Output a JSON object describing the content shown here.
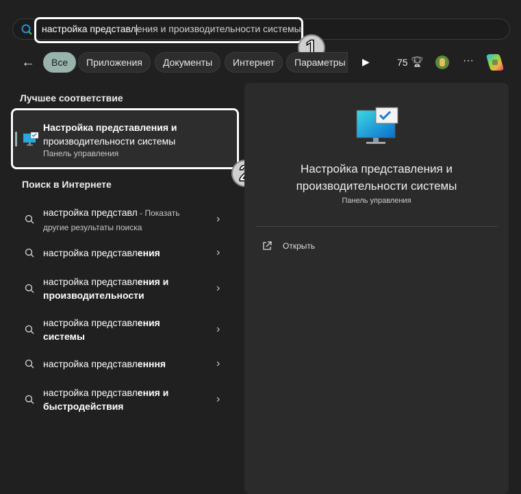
{
  "search": {
    "typed": "настройка представл",
    "completion": "ения и производительности системы"
  },
  "annotations": {
    "one": "1",
    "two": "2"
  },
  "filters": {
    "items": [
      {
        "label": "Все",
        "active": true
      },
      {
        "label": "Приложения"
      },
      {
        "label": "Документы"
      },
      {
        "label": "Интернет"
      },
      {
        "label": "Параметры"
      }
    ],
    "points": "75"
  },
  "best_match": {
    "heading": "Лучшее соответствие",
    "title_line1": "Настройка представления и",
    "title_line2": "производительности системы",
    "subtitle": "Панель управления"
  },
  "web": {
    "heading": "Поиск в Интернете",
    "items": [
      {
        "prefix": "настройка представл",
        "bold": "",
        "extra": " - Показать",
        "line2": "другие результаты поиска",
        "line2_dim": true
      },
      {
        "prefix": "настройка представл",
        "bold": "ения",
        "line2": ""
      },
      {
        "prefix": "настройка представл",
        "bold": "ения и",
        "line2": "производительности"
      },
      {
        "prefix": "настройка представл",
        "bold": "ения",
        "line2": "системы"
      },
      {
        "prefix": "настройка представл",
        "bold": "енння",
        "line2": ""
      },
      {
        "prefix": "настройка представл",
        "bold": "ения и",
        "line2": "быстродействия"
      }
    ]
  },
  "detail": {
    "title": "Настройка представления и производительности системы",
    "subtitle": "Панель управления",
    "open_label": "Открыть"
  },
  "colors": {
    "accent_pill": "#98b2ac",
    "background": "#202020",
    "panel": "#2b2b2b"
  }
}
